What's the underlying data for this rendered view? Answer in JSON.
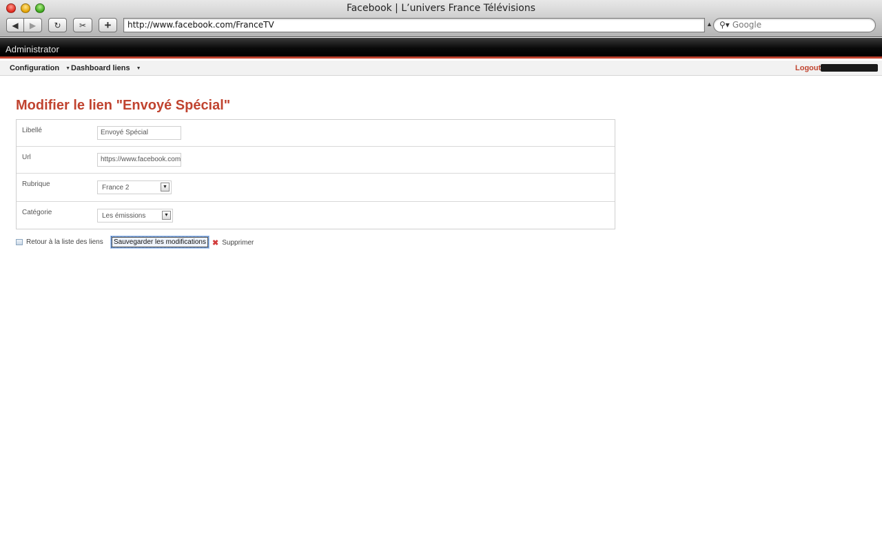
{
  "browser": {
    "window_title": "Facebook | L’univers France Télévisions",
    "url": "http://www.facebook.com/FranceTV",
    "search_placeholder": "Google"
  },
  "admin": {
    "title": "Administrator",
    "nav": {
      "items": [
        {
          "label": "Configuration"
        },
        {
          "label": "Dashboard liens"
        }
      ],
      "logout_label": "Logout"
    }
  },
  "page": {
    "heading": "Modifier le lien \"Envoyé Spécial\"",
    "form": {
      "libelle": {
        "label": "Libellé",
        "value": "Envoyé Spécial"
      },
      "url": {
        "label": "Url",
        "value": "https://www.facebook.com"
      },
      "rubrique": {
        "label": "Rubrique",
        "selected": "France 2"
      },
      "categorie": {
        "label": "Catégorie",
        "selected": "Les émissions"
      }
    },
    "actions": {
      "back_label": "Retour à la liste des liens",
      "save_label": "Sauvegarder les modifications",
      "delete_label": "Supprimer"
    }
  },
  "colors": {
    "accent": "#c0432f",
    "header_bg": "#000000"
  }
}
